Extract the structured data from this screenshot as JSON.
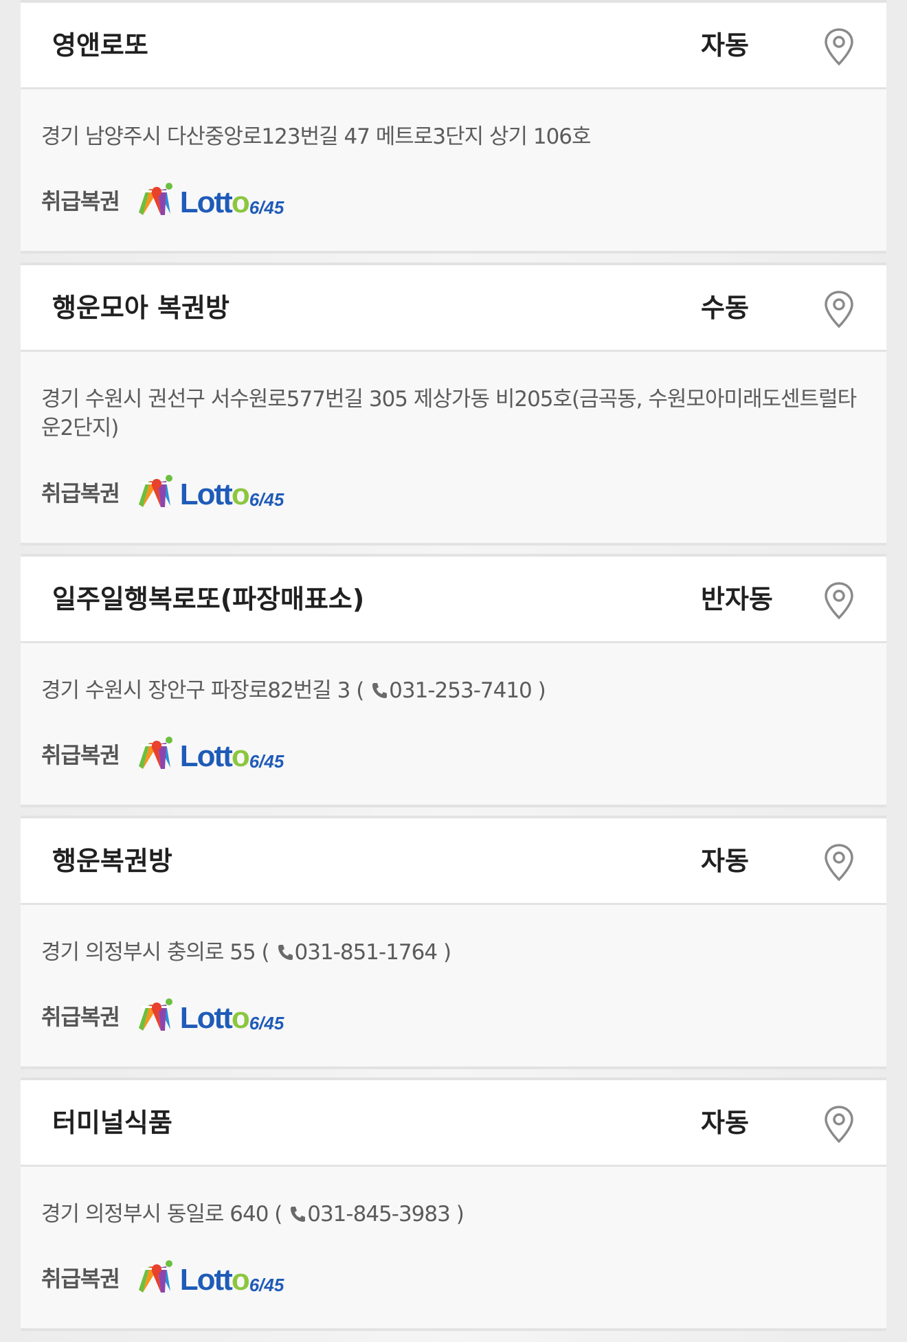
{
  "product_label": "취급복권",
  "lotto_logo": {
    "word_main": "Lott",
    "word_o": "o",
    "number": "6/45"
  },
  "colors": {
    "lotto_blue": "#1f5bb8",
    "lotto_green": "#8cc63f",
    "pin_gray": "#8a8a8a"
  },
  "stores": [
    {
      "name": "영앤로또",
      "type": "자동",
      "address": "경기 남양주시 다산중앙로123번길 47 메트로3단지 상기 106호",
      "phone": ""
    },
    {
      "name": "행운모아 복권방",
      "type": "수동",
      "address": "경기 수원시 권선구 서수원로577번길 305 제상가동 비205호(금곡동, 수원모아미래도센트럴타운2단지)",
      "phone": ""
    },
    {
      "name": "일주일행복로또(파장매표소)",
      "type": "반자동",
      "address": "경기 수원시 장안구 파장로82번길 3",
      "phone": "031-253-7410"
    },
    {
      "name": "행운복권방",
      "type": "자동",
      "address": "경기 의정부시 충의로 55",
      "phone": "031-851-1764"
    },
    {
      "name": "터미널식품",
      "type": "자동",
      "address": "경기 의정부시 동일로 640",
      "phone": "031-845-3983"
    }
  ]
}
